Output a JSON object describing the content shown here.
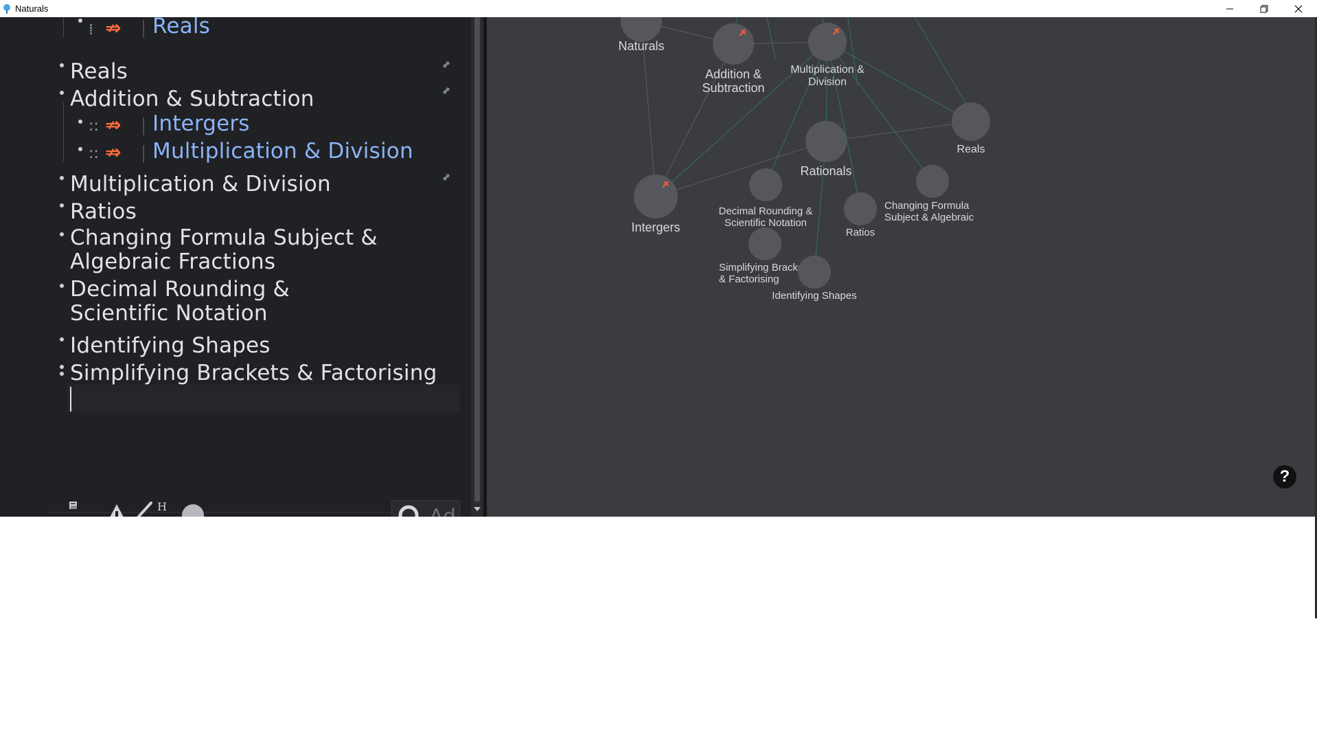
{
  "window": {
    "title": "Naturals",
    "minimize_label": "—",
    "restore_label": "❐",
    "close_label": "✕"
  },
  "outline": {
    "items": [
      {
        "id": "reals-child",
        "text": "Reals",
        "type": "link",
        "relation_icon": "⇏"
      },
      {
        "id": "reals",
        "text": "Reals",
        "type": "item"
      },
      {
        "id": "addsub",
        "text": "Addition & Subtraction",
        "type": "item"
      },
      {
        "id": "intergers-child",
        "text": "Intergers",
        "type": "link",
        "relation_icon": "⇏"
      },
      {
        "id": "muldiv-child",
        "text": "Multiplication & Division",
        "type": "link",
        "relation_icon": "⇏"
      },
      {
        "id": "muldiv",
        "text": "Multiplication & Division",
        "type": "item"
      },
      {
        "id": "ratios",
        "text": "Ratios",
        "type": "item"
      },
      {
        "id": "changing",
        "text": "Changing Formula Subject & Algebraic Fractions",
        "type": "item"
      },
      {
        "id": "decimal",
        "text": "Decimal Rounding & Scientific Notation",
        "type": "item"
      },
      {
        "id": "shapes",
        "text": "Identifying Shapes",
        "type": "item"
      },
      {
        "id": "brackets",
        "text": "Simplifying Brackets & Factorising",
        "type": "item"
      }
    ],
    "handle_glyph": "::",
    "search_placeholder": "Ad"
  },
  "toolbar": {
    "heading_label": "H",
    "icons": [
      "notes-icon",
      "warning-icon",
      "brush-icon",
      "heading-icon",
      "circle-icon",
      "search-icon"
    ]
  },
  "graph": {
    "nodes": [
      {
        "id": "naturals",
        "label": [
          "Naturals"
        ]
      },
      {
        "id": "addsub",
        "label": [
          "Addition &",
          "Subtraction"
        ],
        "pinned": true
      },
      {
        "id": "muldiv",
        "label": [
          "Multiplication &",
          "Division"
        ],
        "pinned": true
      },
      {
        "id": "reals",
        "label": [
          "Reals"
        ]
      },
      {
        "id": "rationals",
        "label": [
          "Rationals"
        ]
      },
      {
        "id": "intergers",
        "label": [
          "Intergers"
        ],
        "pinned": true
      },
      {
        "id": "decimal",
        "label": [
          "Decimal Rounding &",
          "Scientific Notation"
        ]
      },
      {
        "id": "changing",
        "label": [
          "Changing Formula",
          "Subject & Algebraic"
        ]
      },
      {
        "id": "ratios",
        "label": [
          "Ratios"
        ]
      },
      {
        "id": "brackets",
        "label": [
          "Simplifying Brackets",
          "& Factorising"
        ]
      },
      {
        "id": "shapes",
        "label": [
          "Identifying Shapes"
        ]
      }
    ],
    "colors": {
      "node": "#56575c",
      "edge_teal": "#2f6f73",
      "edge_grey": "#5c5d62",
      "pin": "#ff5a36"
    },
    "help_label": "?"
  }
}
